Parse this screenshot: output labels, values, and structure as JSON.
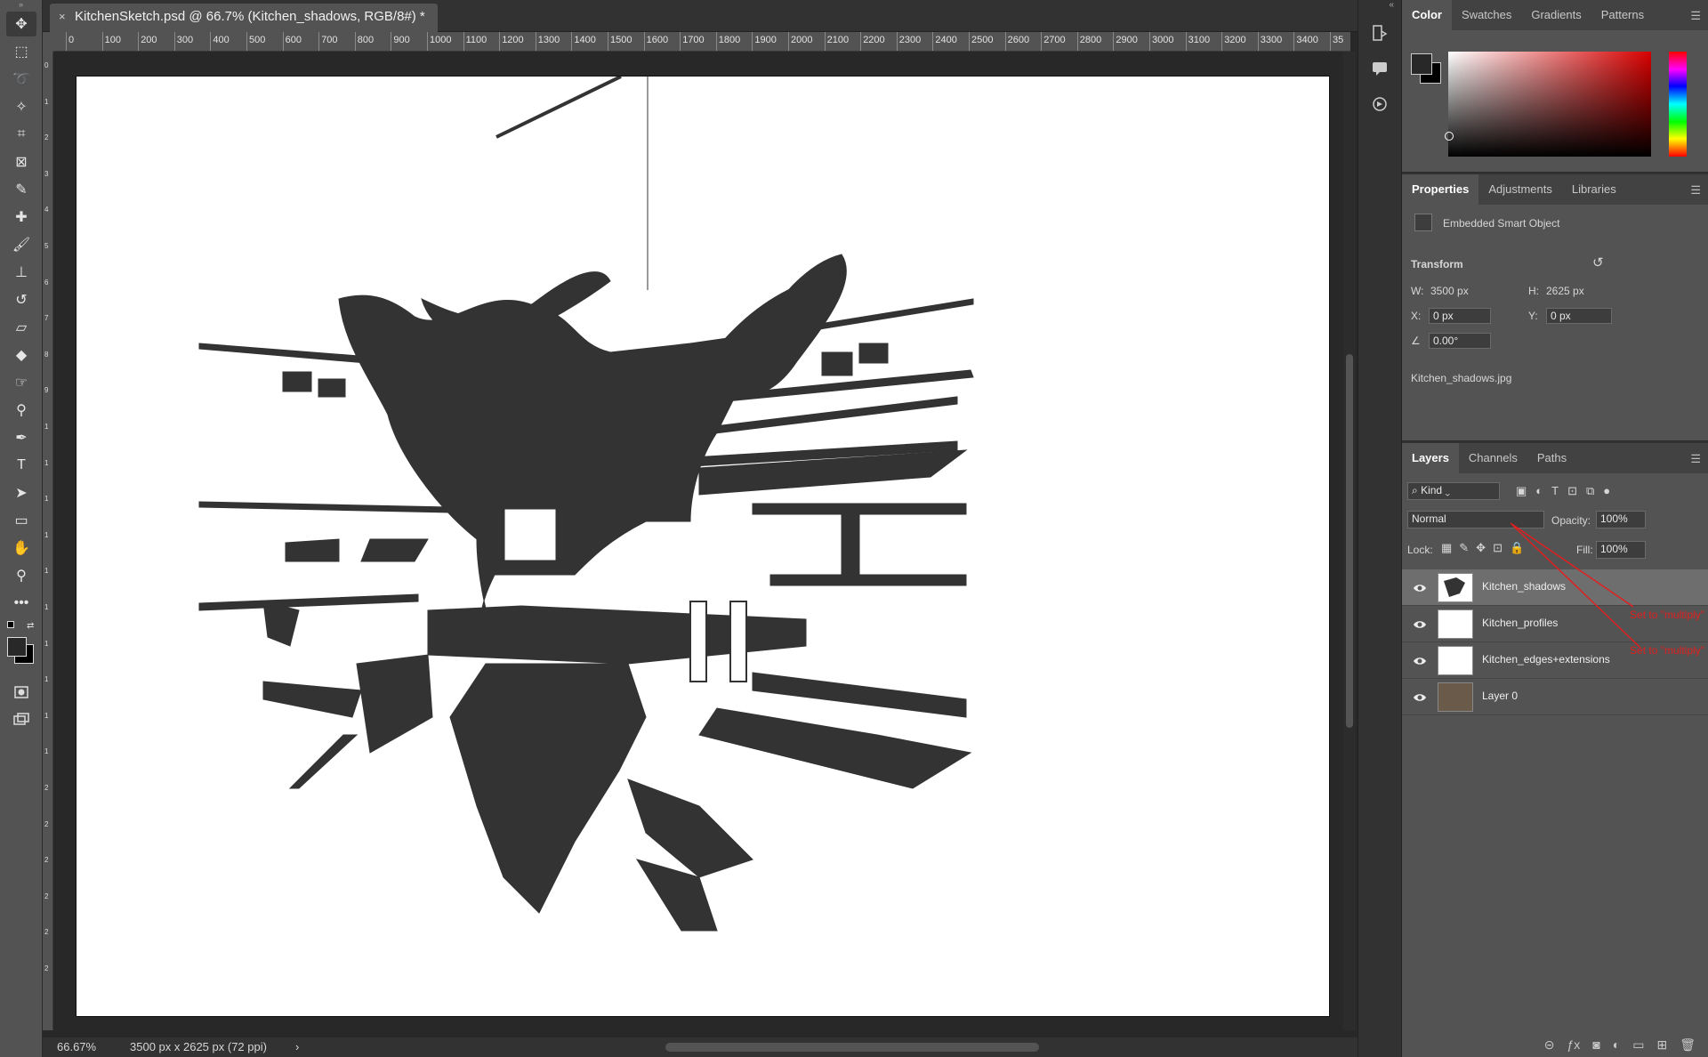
{
  "document": {
    "tab_title": "KitchenSketch.psd @ 66.7% (Kitchen_shadows, RGB/8#) *",
    "close_glyph": "×"
  },
  "rulers": {
    "horizontal": [
      "0",
      "100",
      "200",
      "300",
      "400",
      "500",
      "600",
      "700",
      "800",
      "900",
      "1000",
      "1100",
      "1200",
      "1300",
      "1400",
      "1500",
      "1600",
      "1700",
      "1800",
      "1900",
      "2000",
      "2100",
      "2200",
      "2300",
      "2400",
      "2500",
      "2600",
      "2700",
      "2800",
      "2900",
      "3000",
      "3100",
      "3200",
      "3300",
      "3400",
      "35"
    ],
    "vertical": [
      "0",
      "1",
      "2",
      "3",
      "4",
      "5",
      "6",
      "7",
      "8",
      "9",
      "1",
      "1",
      "1",
      "1",
      "1",
      "1",
      "1",
      "1",
      "1",
      "1",
      "2",
      "2",
      "2",
      "2",
      "2",
      "2"
    ]
  },
  "tools": [
    "move-tool",
    "marquee-tool",
    "lasso-tool",
    "magic-wand-tool",
    "crop-tool",
    "frame-tool",
    "eyedropper-tool",
    "healing-tool",
    "brush-tool",
    "stamp-tool",
    "history-brush-tool",
    "eraser-tool",
    "bucket-tool",
    "smudge-tool",
    "dodge-tool",
    "pen-tool",
    "type-tool",
    "path-select-tool",
    "rectangle-tool",
    "hand-tool",
    "zoom-tool",
    "more-tools"
  ],
  "status": {
    "zoom": "66.67%",
    "doc_info": "3500 px x 2625 px (72 ppi)",
    "arrow": "›"
  },
  "color_panel": {
    "tabs": [
      "Color",
      "Swatches",
      "Gradients",
      "Patterns"
    ],
    "active": "Color",
    "hue_color": "#d80000"
  },
  "properties_panel": {
    "tabs": [
      "Properties",
      "Adjustments",
      "Libraries"
    ],
    "object_type": "Embedded Smart Object",
    "transform_label": "Transform",
    "w_label": "W:",
    "w_value": "3500 px",
    "h_label": "H:",
    "h_value": "2625 px",
    "x_label": "X:",
    "x_value": "0 px",
    "y_label": "Y:",
    "y_value": "0 px",
    "angle_value": "0.00°",
    "source_file": "Kitchen_shadows.jpg"
  },
  "layers_panel": {
    "tabs": [
      "Layers",
      "Channels",
      "Paths"
    ],
    "filter_label": "Kind",
    "blend_mode": "Normal",
    "opacity_label": "Opacity:",
    "opacity_value": "100%",
    "lock_label": "Lock:",
    "fill_label": "Fill:",
    "fill_value": "100%",
    "layers": [
      {
        "name": "Kitchen_shadows",
        "selected": true
      },
      {
        "name": "Kitchen_profiles",
        "selected": false
      },
      {
        "name": "Kitchen_edges+extensions",
        "selected": false
      },
      {
        "name": "Layer 0",
        "selected": false
      }
    ],
    "annotations": [
      "Set to \"multiply\"",
      "Set to \"multiply\""
    ],
    "annotation_color": "#e02020"
  }
}
